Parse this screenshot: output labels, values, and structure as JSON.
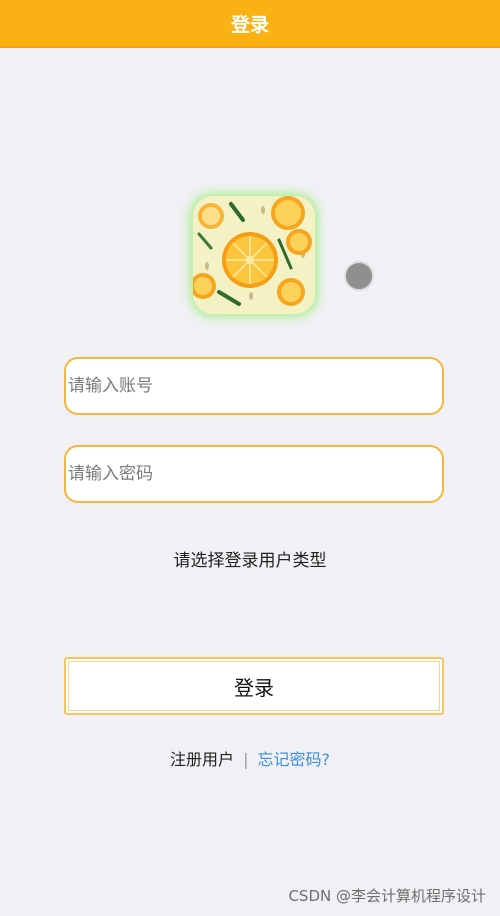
{
  "header": {
    "title": "登录"
  },
  "logo": {
    "icon": "orange-slices-logo"
  },
  "status": {
    "icon": "status-dot-icon",
    "color": "#8f8f91"
  },
  "form": {
    "account_placeholder": "请输入账号",
    "password_placeholder": "请输入密码",
    "user_type_prompt": "请选择登录用户类型",
    "submit_label": "登录"
  },
  "links": {
    "register_label": "注册用户",
    "divider": "|",
    "forgot_label": "忘记密码?"
  },
  "watermark": "CSDN @李会计算机程序设计",
  "colors": {
    "header": "#f9b114",
    "accent_border": "#f5b73a",
    "link": "#3b8fdb",
    "background": "#f1f0f4"
  }
}
